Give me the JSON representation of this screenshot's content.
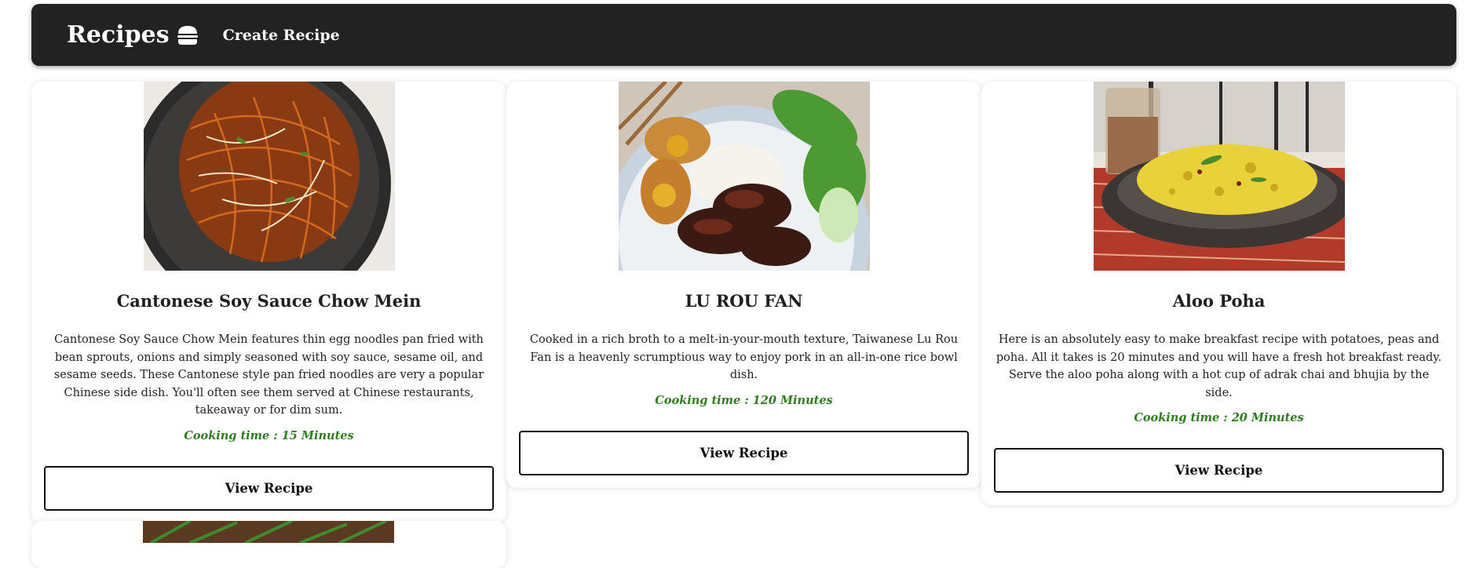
{
  "navbar": {
    "brand": "Recipes",
    "brand_icon": "burger-icon",
    "create_link": "Create Recipe"
  },
  "recipes": [
    {
      "title": "Cantonese Soy Sauce Chow Mein",
      "description": "Cantonese Soy Sauce Chow Mein features thin egg noodles pan fried with bean sprouts, onions and simply seasoned with soy sauce, sesame oil, and sesame seeds. These Cantonese style pan fried noodles are very a popular Chinese side dish. You'll often see them served at Chinese restaurants, takeaway or for dim sum.",
      "cooking_time": "Cooking time : 15 Minutes",
      "button": "View Recipe"
    },
    {
      "title": "LU ROU FAN",
      "description": "Cooked in a rich broth to a melt-in-your-mouth texture, Taiwanese Lu Rou Fan is a heavenly scrumptious way to enjoy pork in an all-in-one rice bowl dish.",
      "cooking_time": "Cooking time : 120 Minutes",
      "button": "View Recipe"
    },
    {
      "title": "Aloo Poha",
      "description": "Here is an absolutely easy to make breakfast recipe with potatoes, peas and poha. All it takes is 20 minutes and you will have a fresh hot breakfast ready. Serve the aloo poha along with a hot cup of adrak chai and bhujia by the side.",
      "cooking_time": "Cooking time : 20 Minutes",
      "button": "View Recipe"
    }
  ],
  "colors": {
    "navbar_bg": "#222222",
    "cooking_time": "#2e7d1f"
  }
}
